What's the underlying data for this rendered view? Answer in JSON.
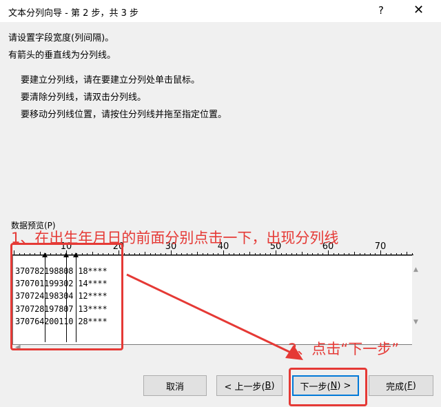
{
  "window": {
    "title": "文本分列向导 - 第 2 步，共 3 步",
    "help": "?",
    "close": "✕"
  },
  "instructions": {
    "line1": "请设置字段宽度(列间隔)。",
    "line2": "有箭头的垂直线为分列线。",
    "tip1": "要建立分列线，请在要建立分列处单击鼠标。",
    "tip2": "要清除分列线，请双击分列线。",
    "tip3": "要移动分列线位置，请按住分列线并拖至指定位置。"
  },
  "preview": {
    "label": "数据预览(P)",
    "ruler_numbers": [
      "10",
      "20",
      "30",
      "40",
      "50",
      "60",
      "70"
    ],
    "rows": [
      "370782198808 18****",
      "370701199302 14****",
      "370724198304 12****",
      "370728197807 13****",
      "370764200110 28****"
    ]
  },
  "annotations": {
    "note1": "1、在出生年月日的前面分别点击一下，出现分列线",
    "note2": "2、点击“下一步”"
  },
  "buttons": {
    "cancel": "取消",
    "back_prefix": "< 上一步(",
    "back_key": "B",
    "back_suffix": ")",
    "next_prefix": "下一步(",
    "next_key": "N",
    "next_suffix": ") >",
    "finish_prefix": "完成(",
    "finish_key": "F",
    "finish_suffix": ")"
  },
  "colors": {
    "annotation": "#e53935",
    "focus": "#0078d7"
  }
}
